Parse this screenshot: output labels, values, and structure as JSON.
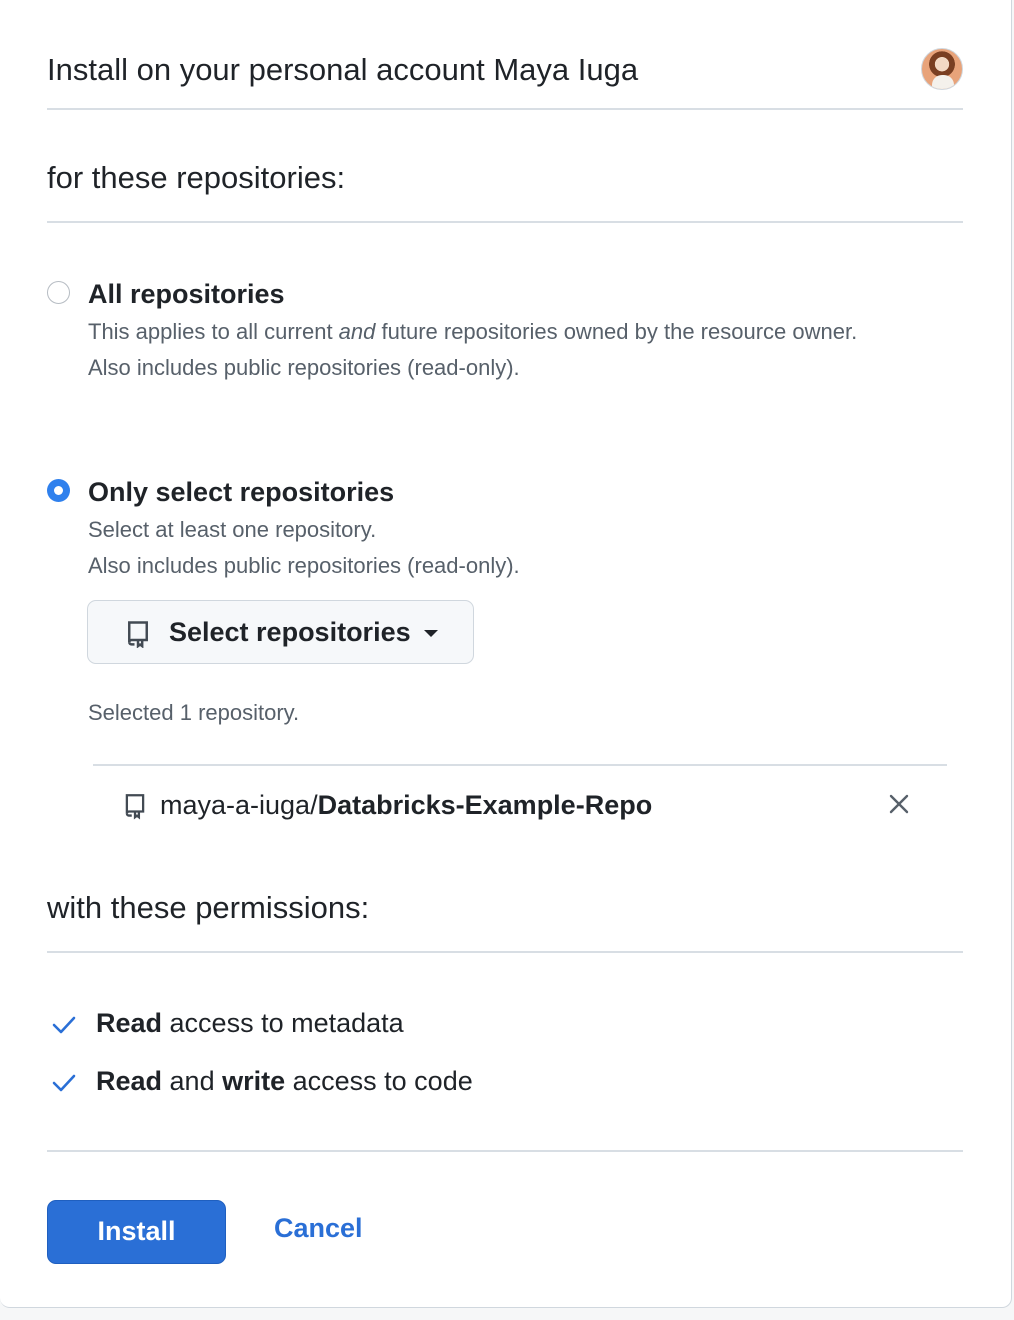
{
  "header": {
    "title": "Install on your personal account Maya Iuga",
    "avatar_icon": "user-avatar"
  },
  "repos_section": {
    "title": "for these repositories:",
    "options": [
      {
        "title": "All repositories",
        "desc_pre": "This applies to all current ",
        "desc_em": "and",
        "desc_post": " future repositories owned by the resource owner.",
        "desc_line2": "Also includes public repositories (read-only).",
        "checked": false
      },
      {
        "title": "Only select repositories",
        "desc_line1": "Select at least one repository.",
        "desc_line2": "Also includes public repositories (read-only).",
        "checked": true
      }
    ],
    "select_button_label": "Select repositories",
    "selected_count": "Selected 1 repository.",
    "selected_repo": {
      "owner": "maya-a-iuga/",
      "name": "Databricks-Example-Repo"
    }
  },
  "perms_section": {
    "title": "with these permissions:",
    "items": [
      {
        "b1": "Read",
        "t1": " access to metadata"
      },
      {
        "b1": "Read",
        "t1": " and ",
        "b2": "write",
        "t2": " access to code"
      }
    ]
  },
  "actions": {
    "install_label": "Install",
    "cancel_label": "Cancel"
  },
  "colors": {
    "accent": "#2a6fd6",
    "radio_checked": "#2f80ed"
  }
}
